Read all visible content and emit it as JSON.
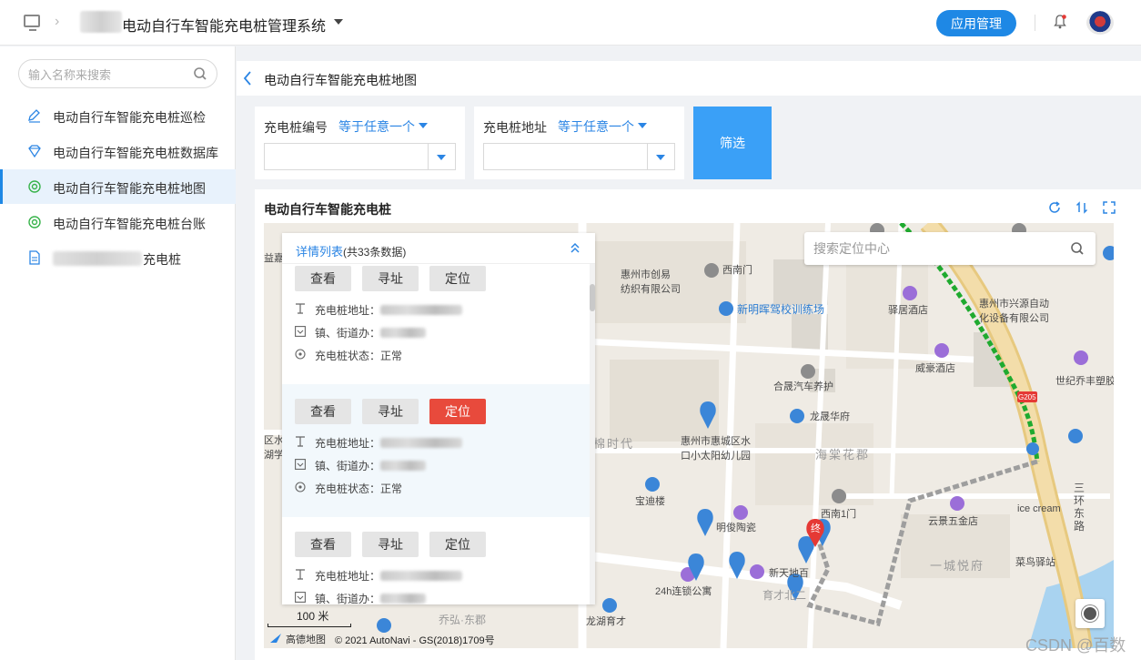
{
  "header": {
    "system_title": "电动自行车智能充电桩管理系统",
    "app_manage_label": "应用管理",
    "colors": {
      "accent": "#1e88e5"
    }
  },
  "sidebar": {
    "search_placeholder": "输入名称来搜索",
    "items": [
      {
        "label": "电动自行车智能充电桩巡检",
        "icon": "edit-icon",
        "active": false
      },
      {
        "label": "电动自行车智能充电桩数据库",
        "icon": "diamond-icon",
        "active": false
      },
      {
        "label": "电动自行车智能充电桩地图",
        "icon": "target-icon",
        "active": true
      },
      {
        "label": "电动自行车智能充电桩台账",
        "icon": "target-icon",
        "active": false
      },
      {
        "label": "充电桩",
        "icon": "document-icon",
        "active": false
      }
    ]
  },
  "page": {
    "title": "电动自行车智能充电桩地图"
  },
  "filters": [
    {
      "label": "充电桩编号",
      "operator": "等于任意一个",
      "value": ""
    },
    {
      "label": "充电桩地址",
      "operator": "等于任意一个",
      "value": ""
    }
  ],
  "filter_button_label": "筛选",
  "map_card": {
    "title": "电动自行车智能充电桩",
    "location_search_placeholder": "搜索定位中心",
    "detail_panel": {
      "title": "详情列表",
      "count": "(共33条数据)",
      "records": [
        {
          "buttons": [
            "查看",
            "寻址",
            "定位"
          ],
          "active_button": -1,
          "address_label": "充电桩地址：",
          "street_label": "镇、街道办：",
          "status_label": "充电桩状态：",
          "status": "正常"
        },
        {
          "buttons": [
            "查看",
            "寻址",
            "定位"
          ],
          "active_button": 2,
          "address_label": "充电桩地址：",
          "street_label": "镇、街道办：",
          "status_label": "充电桩状态：",
          "status": "正常"
        },
        {
          "buttons": [
            "查看",
            "寻址",
            "定位"
          ],
          "active_button": -1,
          "address_label": "充电桩地址：",
          "street_label": "镇、街道办：",
          "status_label": "",
          "status": ""
        }
      ]
    },
    "map_labels": {
      "l1": "惠州市创易",
      "l2": "纺织有限公司",
      "l3": "西南门",
      "l4": "新明晖驾校训练场",
      "l5": "驿居酒店",
      "l6": "惠州市兴源自动",
      "l7": "化设备有限公司",
      "l8": "威豪酒店",
      "l9": "世纪乔丰塑胶",
      "l10": "合晟汽车养护",
      "l11": "龙晟华府",
      "l12": "惠州市惠城区水",
      "l13": "口小太阳幼儿园",
      "l14": "海棠花郡",
      "l15": "棉时代",
      "l16": "宝迪楼",
      "l17": "西南1门",
      "l18": "明俊陶瓷",
      "l19": "云景五金店",
      "l20": "ice cream",
      "l21": "24h连锁公寓",
      "l22": "新天地百",
      "l23": "菜鸟驿站",
      "l24": "一城悦府",
      "l25": "三环东路",
      "l26": "龙湖育才",
      "l27": "乔弘·东郡",
      "l28": "益嘉",
      "l29": "区水",
      "l30": "湖学",
      "l31": "育才北二",
      "l32": "G205",
      "end_marker": "终"
    },
    "scale_label": "100 米",
    "logo_label": "高德地图",
    "copyright": "© 2021 AutoNavi - GS(2018)1709号",
    "route_color": "#1faa2f"
  },
  "watermark": "CSDN @百数"
}
